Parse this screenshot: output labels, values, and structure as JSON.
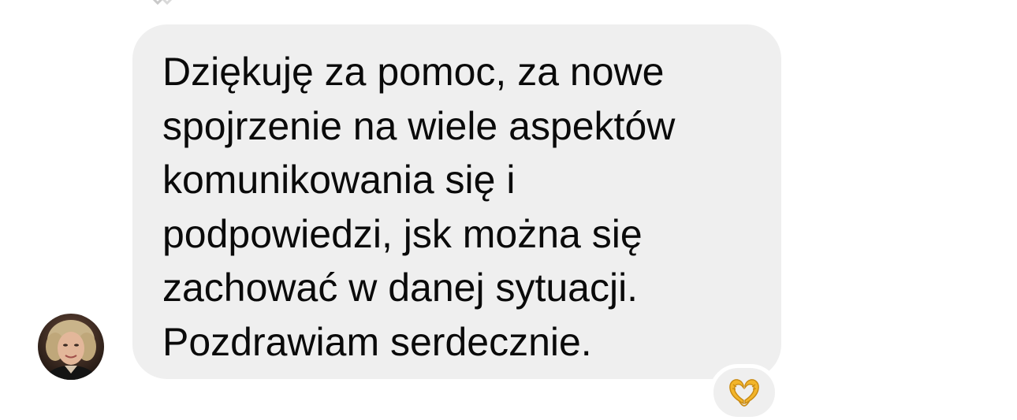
{
  "message": {
    "text": "Dziękuję za pomoc, za nowe\nspojrzenie na wiele aspektów\nkomunikowania się i\npodpowiedzi, jsk można się\nzachować w danej sytuacji.\nPozdrawiam serdecznie.",
    "bubble_color": "#efefef",
    "text_color": "#0a0a0a"
  },
  "sender": {
    "avatar_icon": "profile-photo"
  },
  "reaction": {
    "icon": "heart-hands-emoji",
    "color": "#f2b52b"
  }
}
